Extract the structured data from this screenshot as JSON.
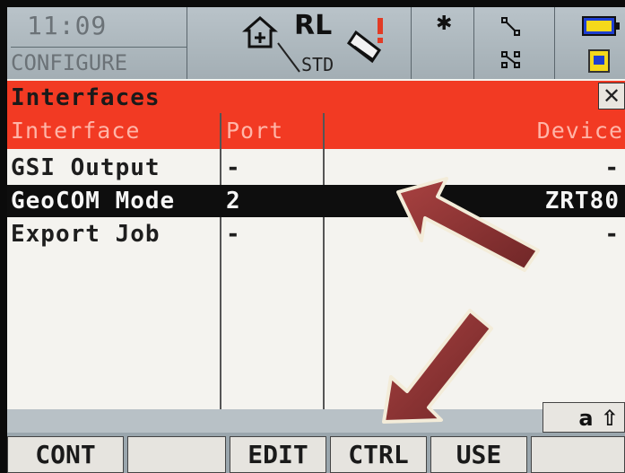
{
  "status": {
    "time": "11:09",
    "mode": "CONFIGURE",
    "target": "RL",
    "measure_mode": "STD",
    "icons": [
      "house-station-icon",
      "prism-icon",
      "bluetooth-icon",
      "network-icon",
      "battery-icon",
      "memory-card-icon"
    ]
  },
  "window": {
    "title": "Interfaces",
    "close_glyph": "✕"
  },
  "table": {
    "headers": {
      "interface": "Interface",
      "port": "Port",
      "device": "Device"
    },
    "rows": [
      {
        "interface": "GSI Output",
        "port": "-",
        "device": "-",
        "selected": false
      },
      {
        "interface": "GeoCOM Mode",
        "port": "2",
        "device": "ZRT80",
        "selected": true
      },
      {
        "interface": "Export Job",
        "port": "-",
        "device": "-",
        "selected": false
      }
    ]
  },
  "input_indicator": "a ⇧",
  "softkeys": [
    "CONT",
    "",
    "EDIT",
    "CTRL",
    "USE",
    ""
  ],
  "colors": {
    "header_red": "#f23a23",
    "selection_black": "#0e0e0e",
    "arrow": "#8e3433"
  }
}
